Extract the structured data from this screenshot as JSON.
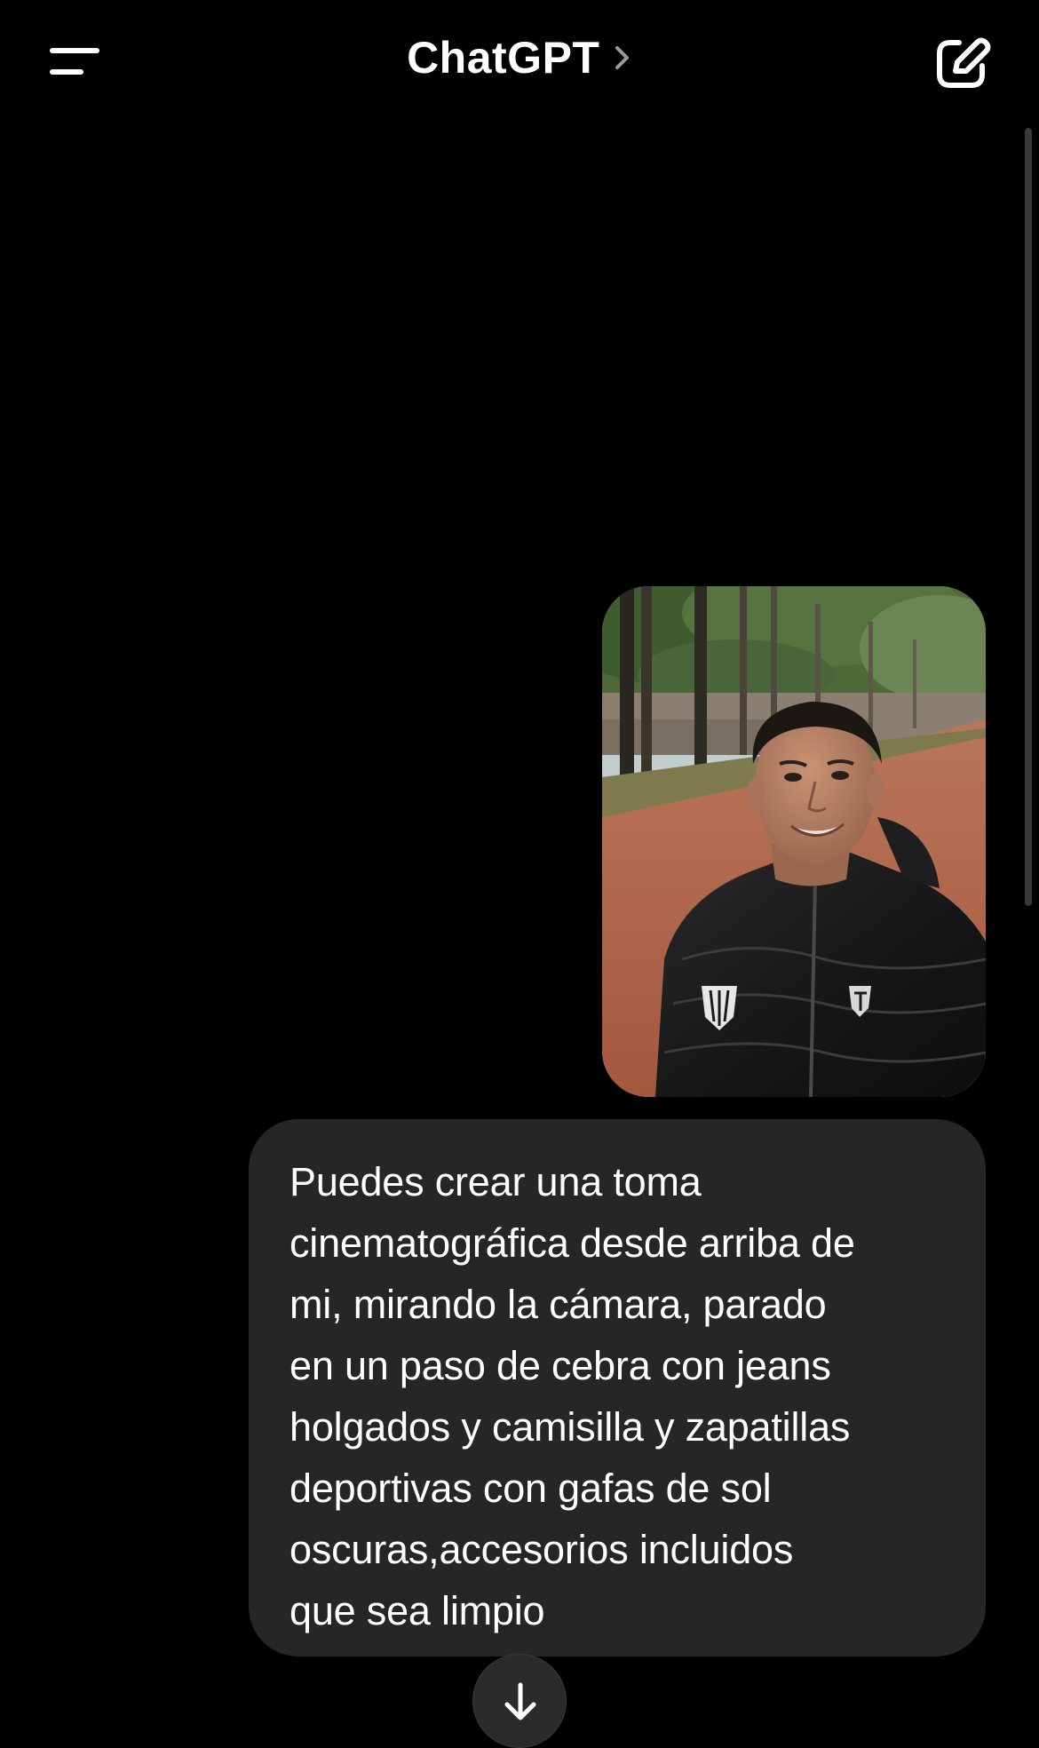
{
  "header": {
    "title": "ChatGPT",
    "menu_icon": "menu-icon",
    "title_chevron_icon": "chevron-right-icon",
    "new_chat_icon": "compose-icon"
  },
  "conversation": {
    "user_image": {
      "description_icon": "photo-attachment"
    },
    "user_message": "Puedes crear una toma\ncinematográfica desde arriba de\nmi, mirando la cámara, parado\nen un paso de cebra con jeans\nholgados y camisilla y zapatillas\ndeportivas con gafas de sol\noscuras,accesorios incluidos\nque sea limpio"
  },
  "controls": {
    "scroll_down_icon": "arrow-down-icon"
  },
  "colors": {
    "background": "#000000",
    "bubble": "#262626",
    "text": "#ffffff"
  }
}
